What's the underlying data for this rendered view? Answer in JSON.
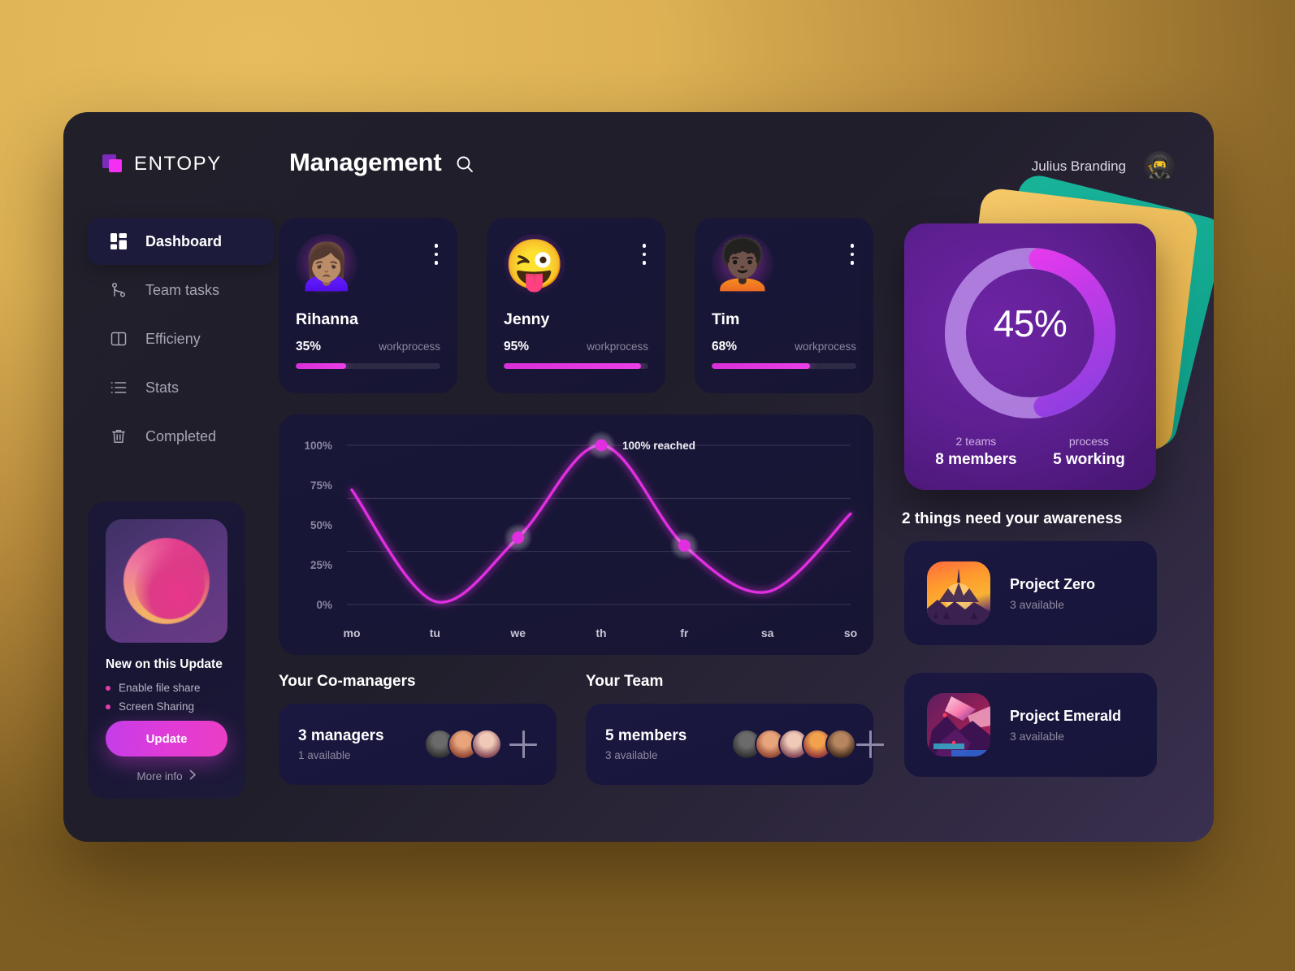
{
  "brand": {
    "name": "ENTOPY",
    "logo_icon": "logo-squares-icon"
  },
  "header": {
    "page_title": "Management",
    "search_icon": "search-icon",
    "user_name": "Julius Branding",
    "user_avatar_glyph": "🥷"
  },
  "sidebar": {
    "items": [
      {
        "label": "Dashboard",
        "icon": "grid-dashboard-icon",
        "active": true
      },
      {
        "label": "Team tasks",
        "icon": "branch-icon",
        "active": false
      },
      {
        "label": "Efficieny",
        "icon": "columns-icon",
        "active": false
      },
      {
        "label": "Stats",
        "icon": "list-icon",
        "active": false
      },
      {
        "label": "Completed",
        "icon": "trash-icon",
        "active": false
      }
    ]
  },
  "update_card": {
    "title": "New on this Update",
    "features": [
      "Enable file share",
      "Screen Sharing"
    ],
    "button_label": "Update",
    "more_info_label": "More info",
    "chevron_icon": "chevron-right-icon"
  },
  "members": [
    {
      "name": "Rihanna",
      "percent": "35%",
      "value": 35,
      "process_label": "workprocess",
      "avatar_glyph": "🙍🏽‍♀️",
      "menu_icon": "kebab-menu-icon"
    },
    {
      "name": "Jenny",
      "percent": "95%",
      "value": 95,
      "process_label": "workprocess",
      "avatar_glyph": "😜",
      "menu_icon": "kebab-menu-icon"
    },
    {
      "name": "Tim",
      "percent": "68%",
      "value": 68,
      "process_label": "workprocess",
      "avatar_glyph": "🧑🏿‍🦱",
      "menu_icon": "kebab-menu-icon"
    }
  ],
  "chart_data": {
    "type": "line",
    "title": "",
    "xlabel": "",
    "ylabel": "",
    "categories": [
      "mo",
      "tu",
      "we",
      "th",
      "fr",
      "sa",
      "so"
    ],
    "x_tick_labels": [
      "mo",
      "tu",
      "we",
      "th",
      "fr",
      "sa",
      "so"
    ],
    "y_tick_labels": [
      "100%",
      "75%",
      "50%",
      "25%",
      "0%"
    ],
    "ylim": [
      0,
      100
    ],
    "grid": true,
    "legend": "none",
    "series": [
      {
        "name": "workprocess",
        "values": [
          72,
          2,
          42,
          100,
          37,
          8,
          57
        ],
        "color": "#e02ee0"
      }
    ],
    "markers": [
      {
        "x_label": "we",
        "value": 42
      },
      {
        "x_label": "th",
        "value": 100
      },
      {
        "x_label": "fr",
        "value": 37
      }
    ],
    "annotations": [
      {
        "text": "100% reached",
        "x_label": "th",
        "value": 100
      }
    ]
  },
  "co_managers": {
    "heading": "Your Co-managers",
    "count_label": "3 managers",
    "available_label": "1 available",
    "avatar_count": 3,
    "add_icon": "plus-icon"
  },
  "team": {
    "heading": "Your Team",
    "count_label": "5 members",
    "available_label": "3 available",
    "avatar_count": 5,
    "add_icon": "plus-icon"
  },
  "donut": {
    "percent_label": "45%",
    "value": 45,
    "teams_label": "2 teams",
    "members_value": "8 members",
    "process_label": "process",
    "working_value": "5 working",
    "ring_start_color": "#f63bf0",
    "ring_end_color": "#8d3fe0",
    "ring_track_color": "#bb8ce8",
    "card_color": "#5d1f90",
    "deco_colors": [
      "#13a88f",
      "#e9bc55"
    ]
  },
  "awareness": {
    "title": "2 things need your awareness",
    "projects": [
      {
        "name": "Project Zero",
        "sub": "3 available",
        "thumb": "sunset-landscape-icon"
      },
      {
        "name": "Project Emerald",
        "sub": "3 available",
        "thumb": "crystal-mountain-icon"
      }
    ]
  }
}
